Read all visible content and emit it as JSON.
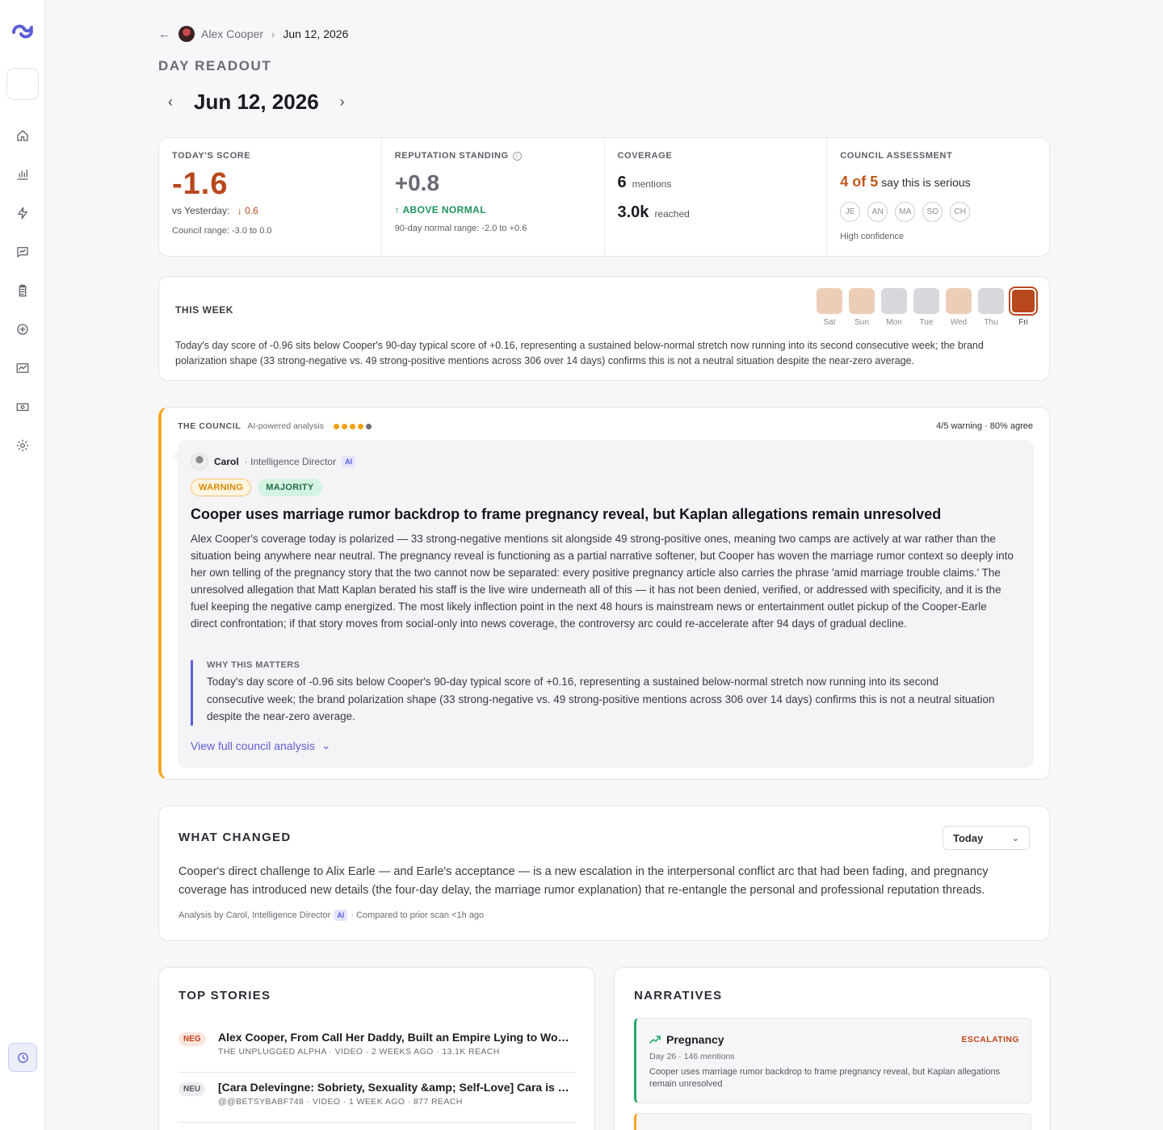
{
  "breadcrumb": {
    "parent": "Alex Cooper",
    "current": "Jun 12, 2026"
  },
  "page_label": "DAY READOUT",
  "date_title": "Jun 12, 2026",
  "stats": {
    "score": {
      "label": "TODAY'S SCORE",
      "value": "-1.6",
      "vs_label": "vs Yesterday:",
      "delta": "0.6",
      "range": "Council range: -3.0 to 0.0"
    },
    "reputation": {
      "label": "REPUTATION STANDING",
      "value": "+0.8",
      "status": "ABOVE NORMAL",
      "range": "90-day normal range: -2.0 to +0.6"
    },
    "coverage": {
      "label": "COVERAGE",
      "mentions": "6",
      "mentions_unit": "mentions",
      "reach": "3.0k",
      "reach_unit": "reached"
    },
    "council": {
      "label": "COUNCIL ASSESSMENT",
      "count": "4 of 5",
      "text": "say this is serious",
      "members": [
        "JE",
        "AN",
        "MA",
        "SO",
        "CH"
      ],
      "confidence": "High confidence"
    }
  },
  "week": {
    "title": "THIS WEEK",
    "days": [
      {
        "label": "Sat",
        "color": "#ebcdb8"
      },
      {
        "label": "Sun",
        "color": "#ebcdb8"
      },
      {
        "label": "Mon",
        "color": "#d7d7dc"
      },
      {
        "label": "Tue",
        "color": "#d7d7dc"
      },
      {
        "label": "Wed",
        "color": "#ebcdb8"
      },
      {
        "label": "Thu",
        "color": "#d7d7dc"
      },
      {
        "label": "Fri",
        "color": "#b8471b"
      }
    ],
    "summary": "Today's day score of -0.96 sits below Cooper's 90-day typical score of +0.16, representing a sustained below-normal stretch now running into its second consecutive week; the brand polarization shape (33 strong-negative vs. 49 strong-positive mentions across 306 over 14 days) confirms this is not a neutral situation despite the near-zero average."
  },
  "council": {
    "title": "THE COUNCIL",
    "subtitle": "AI-powered analysis",
    "stat": "4/5 warning · 80% agree",
    "author": "Carol",
    "role": "· Intelligence Director",
    "ai": "AI",
    "tag_warning": "WARNING",
    "tag_majority": "MAJORITY",
    "headline": "Cooper uses marriage rumor backdrop to frame pregnancy reveal, but Kaplan allegations remain unresolved",
    "body": "Alex Cooper's coverage today is polarized — 33 strong-negative mentions sit alongside 49 strong-positive ones, meaning two camps are actively at war rather than the situation being anywhere near neutral. The pregnancy reveal is functioning as a partial narrative softener, but Cooper has woven the marriage rumor context so deeply into her own telling of the pregnancy story that the two cannot now be separated: every positive pregnancy article also carries the phrase 'amid marriage trouble claims.' The unresolved allegation that Matt Kaplan berated his staff is the live wire underneath all of this — it has not been denied, verified, or addressed with specificity, and it is the fuel keeping the negative camp energized. The most likely inflection point in the next 48 hours is mainstream news or entertainment outlet pickup of the Cooper-Earle direct confrontation; if that story moves from social-only into news coverage, the controversy arc could re-accelerate after 94 days of gradual decline.",
    "why_title": "WHY THIS MATTERS",
    "why_body": "Today's day score of -0.96 sits below Cooper's 90-day typical score of +0.16, representing a sustained below-normal stretch now running into its second consecutive week; the brand polarization shape (33 strong-negative vs. 49 strong-positive mentions across 306 over 14 days) confirms this is not a neutral situation despite the near-zero average.",
    "view_full": "View full council analysis"
  },
  "changed": {
    "title": "WHAT CHANGED",
    "select": "Today",
    "body": "Cooper's direct challenge to Alix Earle — and Earle's acceptance — is a new escalation in the interpersonal conflict arc that had been fading, and pregnancy coverage has introduced new details (the four-day delay, the marriage rumor explanation) that re-entangle the personal and professional reputation threads.",
    "meta_by": "Analysis by Carol, Intelligence Director",
    "meta_ai": "AI",
    "meta_rest": "· Compared to prior scan <1h ago"
  },
  "stories": {
    "title": "TOP STORIES",
    "items": [
      {
        "badge": "NEG",
        "title": "Alex Cooper, From Call Her Daddy, Built an Empire Lying to Women",
        "meta": "THE UNPLUGGED ALPHA · VIDEO · 2 WEEKS AGO · 13.1K REACH"
      },
      {
        "badge": "NEU",
        "title": "[Cara Delevingne: Sobriety, Sexuality &amp; Self-Love] Cara is back",
        "meta": "@@BETSYBABF748 · VIDEO · 1 WEEK AGO · 877 REACH"
      }
    ]
  },
  "narratives": {
    "title": "NARRATIVES",
    "items": [
      {
        "name": "Pregnancy",
        "status": "ESCALATING",
        "meta": "Day 26 · 146 mentions",
        "desc": "Cooper uses marriage rumor backdrop to frame pregnancy reveal, but Kaplan allegations remain unresolved"
      }
    ]
  }
}
